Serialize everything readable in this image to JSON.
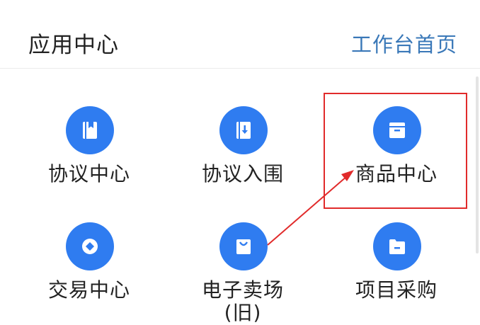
{
  "header": {
    "title": "应用中心",
    "link": "工作台首页"
  },
  "apps": [
    {
      "label": "协议中心",
      "icon": "book-icon"
    },
    {
      "label": "协议入围",
      "icon": "book-download-icon"
    },
    {
      "label": "商品中心",
      "icon": "store-icon"
    },
    {
      "label": "交易中心",
      "icon": "diamond-icon"
    },
    {
      "label": "电子卖场(旧)",
      "label_line1": "电子卖场",
      "label_line2": "(旧)",
      "icon": "shopping-bag-icon"
    },
    {
      "label": "项目采购",
      "icon": "folder-icon"
    }
  ],
  "colors": {
    "icon_circle": "#2f7cf0",
    "link": "#3a78b8",
    "highlight": "#e12b2b",
    "text": "#222222"
  }
}
